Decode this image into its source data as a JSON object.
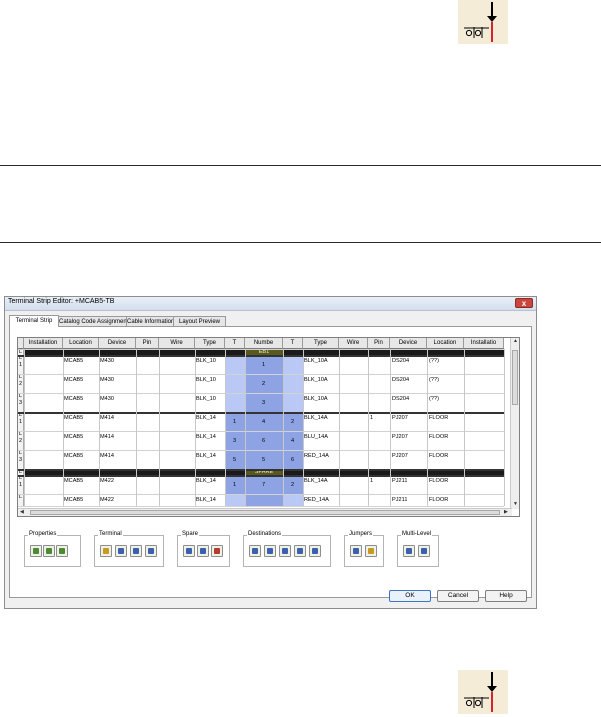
{
  "window": {
    "title": "Terminal Strip Editor: +MCAB5-TB",
    "close_symbol": "x"
  },
  "tabs": [
    "Terminal Strip",
    "Catalog Code Assignment",
    "Cable Information",
    "Layout Preview"
  ],
  "columns": [
    "Installation",
    "Location",
    "Device",
    "Pin",
    "Wire",
    "Type",
    "T",
    "Numbe",
    "T",
    "Type",
    "Wire",
    "Pin",
    "Device",
    "Location",
    "Installatio"
  ],
  "rows": [
    {
      "rl": "L",
      "rn": "",
      "band": "EB1"
    },
    {
      "rl": "L",
      "rn": "1",
      "loc": "MCAB5",
      "dev": "M430",
      "type": "BLK_10",
      "t1": "",
      "num": "1",
      "t2": "",
      "type2": "BLK_10A",
      "pin2": "",
      "dev2": "DS204",
      "loc2": "(??)"
    },
    {
      "rl": "L",
      "rn": "2",
      "loc": "MCAB5",
      "dev": "M430",
      "type": "BLK_10",
      "t1": "",
      "num": "2",
      "t2": "",
      "type2": "BLK_10A",
      "pin2": "",
      "dev2": "DS204",
      "loc2": "(??)"
    },
    {
      "rl": "L",
      "rn": "3",
      "loc": "MCAB5",
      "dev": "M430",
      "type": "BLK_10",
      "t1": "",
      "num": "3",
      "t2": "",
      "type2": "BLK_10A",
      "pin2": "",
      "dev2": "DS204",
      "loc2": "(??)"
    },
    {
      "rl": "L",
      "rn": "1",
      "loc": "MCAB5",
      "dev": "M414",
      "type": "BLK_14",
      "t1": "1",
      "num": "4",
      "t2": "2",
      "type2": "BLK_14A",
      "pin2": "1",
      "dev2": "PJ207",
      "loc2": "FLOOR"
    },
    {
      "rl": "L",
      "rn": "2",
      "loc": "MCAB5",
      "dev": "M414",
      "type": "BLK_14",
      "t1": "3",
      "num": "6",
      "t2": "4",
      "type2": "BLU_14A",
      "pin2": "",
      "dev2": "PJ207",
      "loc2": "FLOOR"
    },
    {
      "rl": "L",
      "rn": "3",
      "loc": "MCAB5",
      "dev": "M414",
      "type": "BLK_14",
      "t1": "5",
      "num": "5",
      "t2": "6",
      "type2": "RED_14A",
      "pin2": "",
      "dev2": "PJ207",
      "loc2": "FLOOR"
    },
    {
      "rl": "L",
      "rn": "",
      "band": "SPARE"
    },
    {
      "rl": "L",
      "rn": "1",
      "loc": "MCAB5",
      "dev": "M422",
      "type": "BLK_14",
      "t1": "1",
      "num": "7",
      "t2": "2",
      "type2": "BLK_14A",
      "pin2": "1",
      "dev2": "PJ211",
      "loc2": "FLOOR"
    },
    {
      "rl": "L",
      "rn": "",
      "loc": "MCAB5",
      "dev": "M422",
      "type": "BLK_14",
      "t1": "",
      "num": "",
      "t2": "",
      "type2": "RED_14A",
      "pin2": "",
      "dev2": "PJ211",
      "loc2": "FLOOR"
    }
  ],
  "groups": [
    {
      "label": "Properties",
      "name": "properties",
      "buttons": [
        "edit-properties",
        "copy-properties",
        "remove-properties"
      ]
    },
    {
      "label": "Terminal",
      "name": "terminal",
      "buttons": [
        "edit-terminal",
        "insert-terminal",
        "move-terminal",
        "renumber-terminal"
      ]
    },
    {
      "label": "Spare",
      "name": "spare",
      "buttons": [
        "add-spare",
        "delete-spare",
        "spare-options"
      ]
    },
    {
      "label": "Destinations",
      "name": "destinations",
      "buttons": [
        "dest-1",
        "dest-2",
        "dest-3",
        "dest-4",
        "dest-5"
      ]
    },
    {
      "label": "Jumpers",
      "name": "jumpers",
      "buttons": [
        "add-jumper",
        "edit-jumper"
      ]
    },
    {
      "label": "Multi-Level",
      "name": "multi-level",
      "buttons": [
        "multi-level-1",
        "multi-level-2"
      ]
    }
  ],
  "buttons": {
    "ok": "OK",
    "cancel": "Cancel",
    "help": "Help"
  },
  "colors": {
    "blue_column": "#b9c8f5",
    "blue_selected": "#8da3e3",
    "header_band": "#1a1a1a",
    "olive_band": "#59581f",
    "icon_bg": "#f4ecd7"
  },
  "icons": {
    "top": "terminal-symbol-icon",
    "bottom": "terminal-symbol-icon"
  }
}
